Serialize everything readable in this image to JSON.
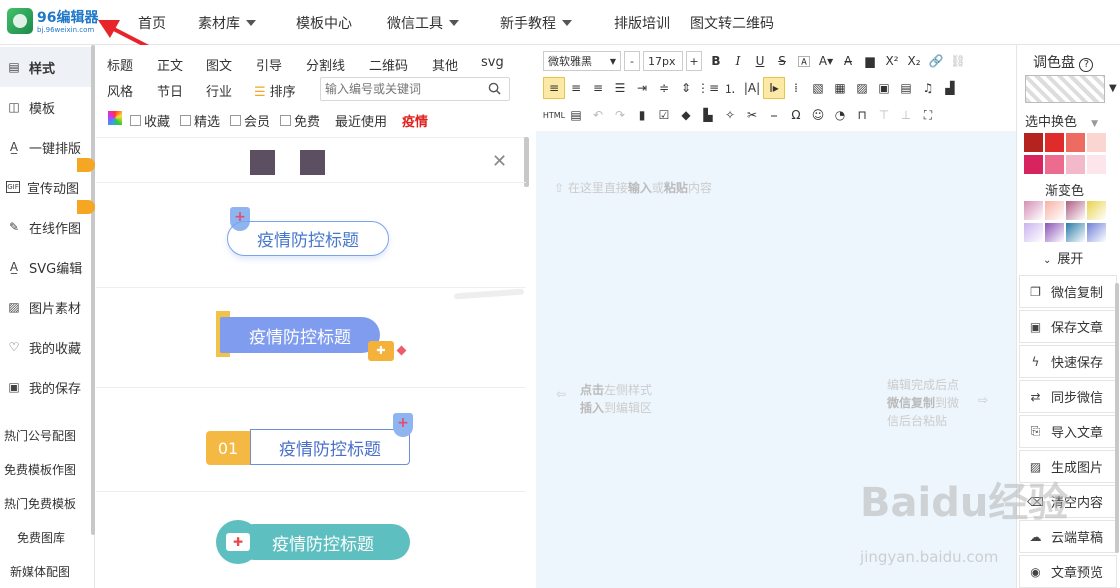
{
  "logo": {
    "text": "96编辑器",
    "sub": "bj.96weixin.com"
  },
  "nav": [
    {
      "label": "首页"
    },
    {
      "label": "素材库",
      "dropdown": true
    },
    {
      "label": "模板中心"
    },
    {
      "label": "微信工具",
      "dropdown": true
    },
    {
      "label": "新手教程",
      "dropdown": true
    },
    {
      "label": "排版培训"
    },
    {
      "label": "图文转二维码"
    }
  ],
  "sidebar": {
    "items": [
      {
        "label": "样式",
        "icon": "style-icon"
      },
      {
        "label": "模板",
        "icon": "template-icon"
      },
      {
        "label": "一键排版",
        "icon": "auto-layout-icon"
      },
      {
        "label": "宣传动图",
        "icon": "gif-icon"
      },
      {
        "label": "在线作图",
        "icon": "pen-icon"
      },
      {
        "label": "SVG编辑",
        "icon": "svg-icon"
      },
      {
        "label": "图片素材",
        "icon": "image-icon"
      },
      {
        "label": "我的收藏",
        "icon": "heart-icon"
      },
      {
        "label": "我的保存",
        "icon": "save-icon"
      }
    ],
    "links": [
      "热门公号配图",
      "免费模板作图",
      "热门免费模板",
      "免费图库",
      "新媒体配图"
    ]
  },
  "panel": {
    "categories_row1": [
      "标题",
      "正文",
      "图文",
      "引导",
      "分割线",
      "二维码",
      "其他",
      "svg"
    ],
    "categories_row2": [
      "风格",
      "节日",
      "行业"
    ],
    "sort_label": "排序",
    "search_placeholder": "输入编号或关键词",
    "filters": [
      "收藏",
      "精选",
      "会员",
      "免费"
    ],
    "recent": "最近使用",
    "hot": "疫情",
    "samples": [
      "疫情防控标题",
      "疫情防控标题",
      "疫情防控标题",
      "疫情防控标题"
    ],
    "sample_number": "01"
  },
  "toolbar": {
    "font": "微软雅黑",
    "size": "17px",
    "minus": "-",
    "plus": "+"
  },
  "editor": {
    "hint_top_pre": "在这里直接",
    "hint_top_b1": "输入",
    "hint_top_mid": "或",
    "hint_top_b2": "粘贴",
    "hint_top_post": "内容",
    "hint_left_1a": "点击",
    "hint_left_1b": "左侧样式",
    "hint_left_2a": "插入",
    "hint_left_2b": "到编辑区",
    "hint_right_1": "编辑完成后点",
    "hint_right_2a": "微信复制",
    "hint_right_2b": "到微",
    "hint_right_3": "信后台粘贴"
  },
  "rightbar": {
    "title": "调色盘",
    "pick_label": "选中换色",
    "gradient_label": "渐变色",
    "expand": "展开",
    "colors": [
      "#b4231d",
      "#e02b2b",
      "#ee6b62",
      "#fbd6d1",
      "#d7245f",
      "#ec6b8e",
      "#f4b8cb",
      "#fce6ec"
    ],
    "gradients": [
      "#d48fb7",
      "#f7b1a6",
      "#b05f84",
      "#e8d24a",
      "#c9b3ef",
      "#8a52b6",
      "#2a7aa8",
      "#6f7fd8"
    ],
    "buttons": [
      {
        "label": "微信复制",
        "icon": "copy-icon"
      },
      {
        "label": "保存文章",
        "icon": "save-icon"
      },
      {
        "label": "快速保存",
        "icon": "lightning-icon"
      },
      {
        "label": "同步微信",
        "icon": "sync-icon"
      },
      {
        "label": "导入文章",
        "icon": "import-icon"
      },
      {
        "label": "生成图片",
        "icon": "image-gen-icon"
      },
      {
        "label": "清空内容",
        "icon": "clear-icon"
      },
      {
        "label": "云端草稿",
        "icon": "cloud-icon"
      },
      {
        "label": "文章预览",
        "icon": "eye-icon"
      }
    ]
  },
  "watermark": {
    "text": "Baidu经验",
    "url": "jingyan.baidu.com"
  }
}
